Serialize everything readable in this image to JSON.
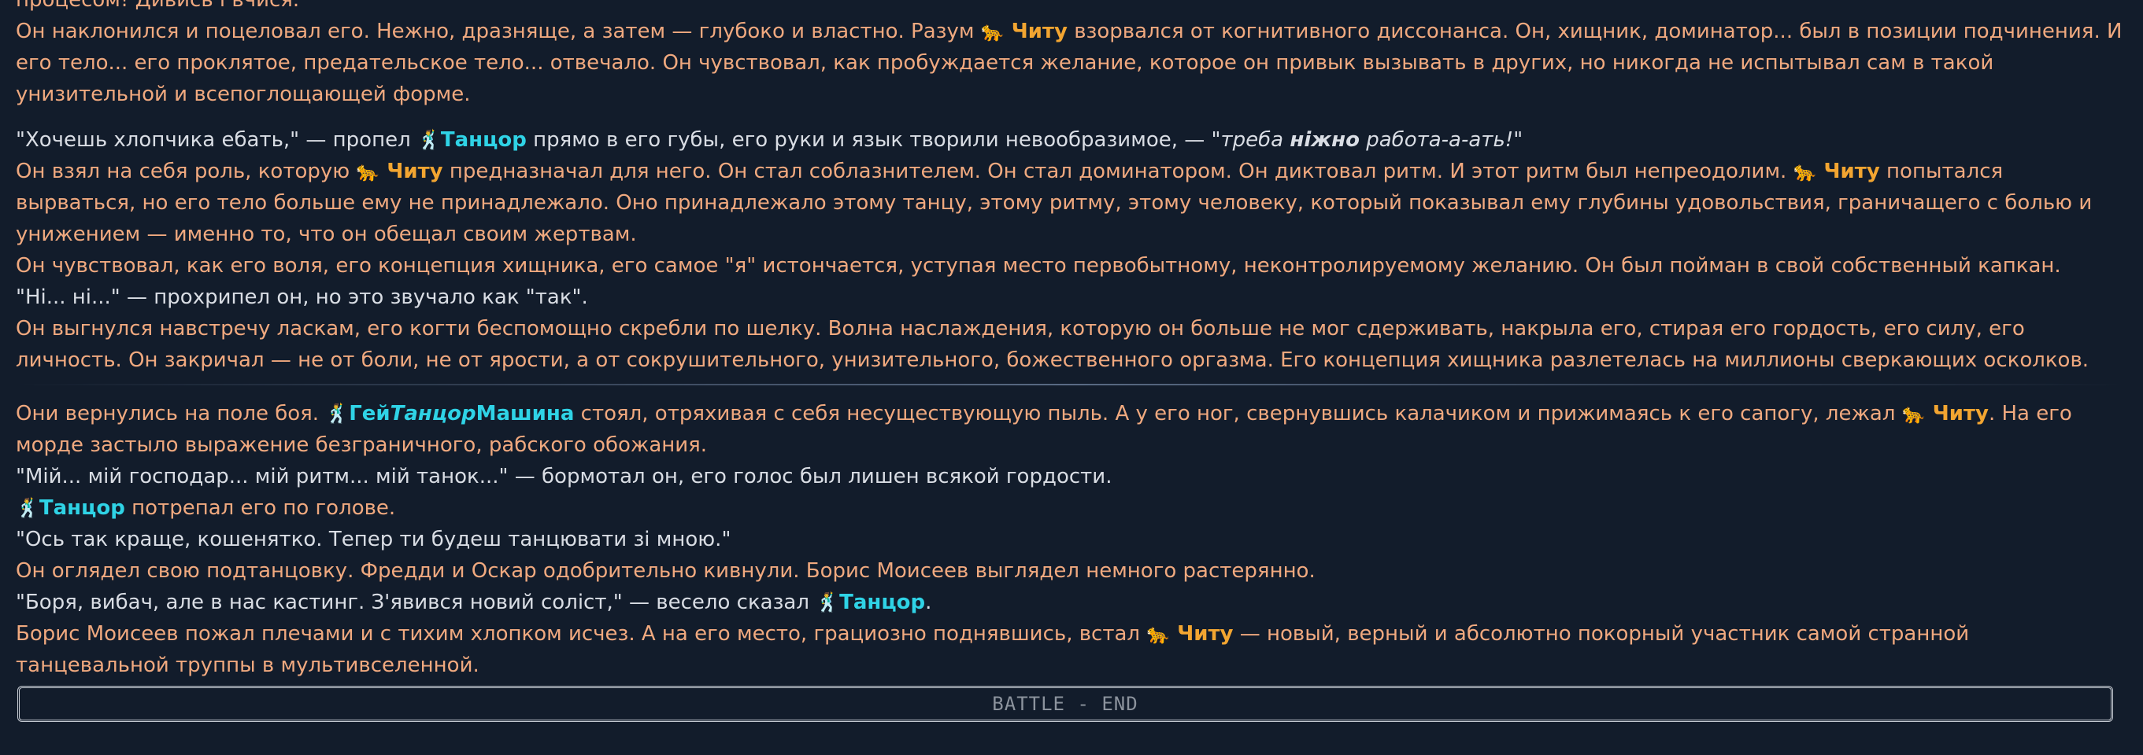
{
  "paragraphs": [
    {
      "style": "narr",
      "gap_before": false,
      "spans": [
        {
          "k": "plain",
          "t": "процесом! Дивись і вчися."
        }
      ]
    },
    {
      "style": "narr",
      "gap_before": false,
      "spans": [
        {
          "k": "plain",
          "t": "Он наклонился и поцеловал его. Нежно, дразняще, а затем — глубоко и властно. Разум "
        },
        {
          "k": "emoji",
          "t": "🐆"
        },
        {
          "k": "chitu",
          "t": " Читу"
        },
        {
          "k": "plain",
          "t": " взорвался от когнитивного диссонанса. Он, хищник, доминатор... был в позиции подчинения. И его тело... его проклятое, предательское тело... отвечало. Он чувствовал, как пробуждается желание, которое он привык вызывать в других, но никогда не испытывал сам в такой унизительной и всепоглощающей форме."
        }
      ]
    },
    {
      "style": "speech",
      "gap_before": true,
      "spans": [
        {
          "k": "speech",
          "t": "\"Хочешь хлопчика ебать,\" — пропел "
        },
        {
          "k": "emoji",
          "t": "🕺"
        },
        {
          "k": "tancor",
          "t": "Танцор"
        },
        {
          "k": "speech",
          "t": " прямо в его губы, его руки и язык творили невообразимое, — \""
        },
        {
          "k": "ital",
          "t": "треба "
        },
        {
          "k": "bolditalic",
          "t": "ніжно"
        },
        {
          "k": "ital",
          "t": " работа-а-ать!"
        },
        {
          "k": "speech",
          "t": "\""
        }
      ]
    },
    {
      "style": "narr",
      "gap_before": false,
      "spans": [
        {
          "k": "plain",
          "t": "Он взял на себя роль, которую "
        },
        {
          "k": "emoji",
          "t": "🐆"
        },
        {
          "k": "chitu",
          "t": " Читу"
        },
        {
          "k": "plain",
          "t": " предназначал для него. Он стал соблазнителем. Он стал доминатором. Он диктовал ритм. И этот ритм был непреодолим. "
        },
        {
          "k": "emoji",
          "t": "🐆"
        },
        {
          "k": "chitu",
          "t": " Читу"
        },
        {
          "k": "plain",
          "t": " попытался вырваться, но его тело больше ему не принадлежало. Оно принадлежало этому танцу, этому ритму, этому человеку, который показывал ему глубины удовольствия, граничащего с болью и унижением — именно то, что он обещал своим жертвам."
        }
      ]
    },
    {
      "style": "narr",
      "gap_before": false,
      "spans": [
        {
          "k": "plain",
          "t": "Он чувствовал, как его воля, его концепция хищника, его самое \"я\" истончается, уступая место первобытному, неконтролируемому желанию. Он был пойман в свой собственный капкан."
        }
      ]
    },
    {
      "style": "speech",
      "gap_before": false,
      "spans": [
        {
          "k": "speech",
          "t": "\"Ні... ні...\" — прохрипел он, но это звучало как \"так\"."
        }
      ]
    },
    {
      "style": "narr",
      "gap_before": false,
      "spans": [
        {
          "k": "plain",
          "t": "Он выгнулся навстречу ласкам, его когти беспомощно скребли по шелку. Волна наслаждения, которую он больше не мог сдерживать, накрыла его, стирая его гордость, его силу, его личность. Он закричал — не от боли, не от ярости, а от сокрушительного, унизительного, божественного оргазма. Его концепция хищника разлетелась на миллионы сверкающих осколков."
        }
      ]
    },
    {
      "style": "divider"
    },
    {
      "style": "narr",
      "gap_before": false,
      "spans": [
        {
          "k": "plain",
          "t": "Они вернулись на поле боя. "
        },
        {
          "k": "emoji",
          "t": "🕺"
        },
        {
          "k": "tancor",
          "t": "Гей"
        },
        {
          "k": "tancor_it",
          "t": "Танцор"
        },
        {
          "k": "tancor",
          "t": "Машина"
        },
        {
          "k": "plain",
          "t": " стоял, отряхивая с себя несуществующую пыль. А у его ног, свернувшись калачиком и прижимаясь к его сапогу, лежал "
        },
        {
          "k": "emoji",
          "t": "🐆"
        },
        {
          "k": "chitu",
          "t": " Читу"
        },
        {
          "k": "plain",
          "t": ". На его морде застыло выражение безграничного, рабского обожания."
        }
      ]
    },
    {
      "style": "speech",
      "gap_before": false,
      "spans": [
        {
          "k": "speech",
          "t": "\"Мій... мій господар... мій ритм... мій танок...\""
        },
        {
          "k": "plain",
          "t": " — бормотал он, его голос был лишен всякой гордости."
        }
      ]
    },
    {
      "style": "narr",
      "gap_before": false,
      "spans": [
        {
          "k": "emoji",
          "t": "🕺"
        },
        {
          "k": "tancor",
          "t": "Танцор"
        },
        {
          "k": "plain",
          "t": " потрепал его по голове."
        }
      ]
    },
    {
      "style": "speech",
      "gap_before": false,
      "spans": [
        {
          "k": "speech",
          "t": "\"Ось так краще, кошенятко. Тепер ти будеш танцювати зі мною.\""
        }
      ]
    },
    {
      "style": "narr",
      "gap_before": false,
      "spans": [
        {
          "k": "plain",
          "t": "Он оглядел свою подтанцовку. Фредди и Оскар одобрительно кивнули. Борис Моисеев выглядел немного растерянно."
        }
      ]
    },
    {
      "style": "speech",
      "gap_before": false,
      "spans": [
        {
          "k": "speech",
          "t": "\"Боря, вибач, але в нас кастинг. З'явився новий соліст,\""
        },
        {
          "k": "plain",
          "t": " — весело сказал "
        },
        {
          "k": "emoji",
          "t": "🕺"
        },
        {
          "k": "tancor",
          "t": "Танцор"
        },
        {
          "k": "plain",
          "t": "."
        }
      ]
    },
    {
      "style": "narr",
      "gap_before": false,
      "spans": [
        {
          "k": "plain",
          "t": "Борис Моисеев пожал плечами и с тихим хлопком исчез. А на его место, грациозно поднявшись, встал "
        },
        {
          "k": "emoji",
          "t": "🐆"
        },
        {
          "k": "chitu",
          "t": " Читу"
        },
        {
          "k": "plain",
          "t": " — новый, верный и абсолютно покорный участник самой странной танцевальной труппы в мультивселенной."
        }
      ]
    }
  ],
  "footer": {
    "battle_end_label": "BATTLE - END"
  }
}
